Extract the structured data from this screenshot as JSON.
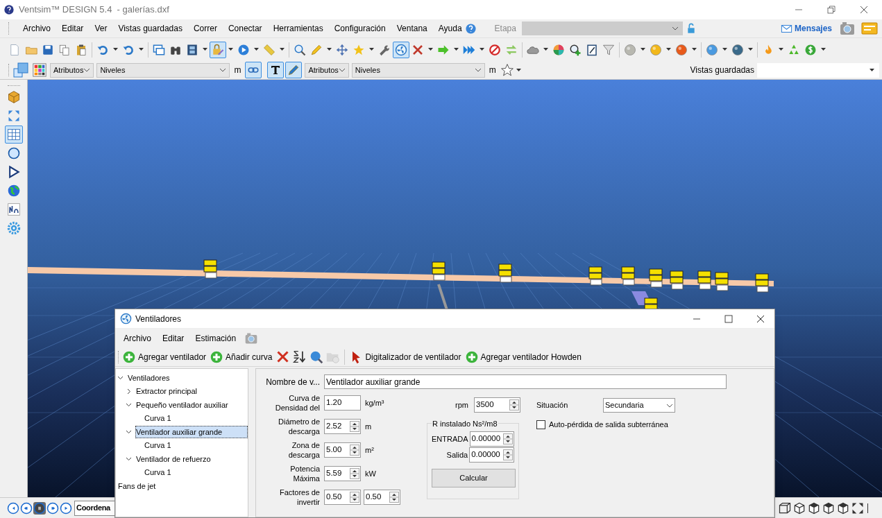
{
  "window": {
    "title": "Ventsim™ DESIGN 5.4  - galerías.dxf"
  },
  "menu": [
    "Archivo",
    "Editar",
    "Ver",
    "Vistas guardadas",
    "Correr",
    "Conectar",
    "Herramientas",
    "Configuración",
    "Ventana",
    "Ayuda"
  ],
  "stage": {
    "label": "Etapa",
    "disabled": true
  },
  "messages": "Mensajes",
  "main_toolbar": [
    {
      "selected": false
    },
    {
      "selected": false
    },
    {
      "selected": false
    },
    {
      "selected": false
    },
    {
      "selected": false
    },
    {
      "selected": false
    },
    {
      "selected": false
    },
    {
      "selected": false
    },
    {
      "selected": false
    },
    {
      "selected": false
    },
    {
      "selected": true
    },
    {
      "selected": false
    },
    {
      "selected": false
    },
    {
      "selected": false
    },
    {
      "selected": false
    },
    {
      "selected": false
    },
    {
      "selected": false
    },
    {
      "selected": false
    },
    {
      "selected": true
    },
    {
      "selected": false
    },
    {
      "selected": false
    },
    {
      "selected": false
    },
    {
      "selected": false
    },
    {
      "selected": false
    },
    {
      "selected": false
    },
    {
      "selected": false
    },
    {
      "selected": false
    },
    {
      "selected": false
    },
    {
      "selected": false
    },
    {
      "selected": false
    },
    {
      "selected": false
    },
    {
      "selected": false
    },
    {
      "selected": false
    },
    {
      "selected": false
    },
    {
      "selected": false
    },
    {
      "selected": false
    },
    {
      "selected": false
    }
  ],
  "view_toolbar": {
    "combos": [
      {
        "value": "Atributos"
      },
      {
        "value": "Niveles"
      },
      {
        "value": "Atributos"
      },
      {
        "value": "Niveles"
      }
    ],
    "units": [
      "m",
      "m"
    ],
    "toggles": [
      {
        "selected": true
      },
      {
        "selected": true
      },
      {
        "selected": true
      }
    ],
    "saved_views_label": "Vistas guardadas"
  },
  "side_toolbar": [
    {
      "selected": false
    },
    {
      "selected": false
    },
    {
      "selected": true
    },
    {
      "selected": false
    },
    {
      "selected": false
    },
    {
      "selected": false
    },
    {
      "selected": false
    },
    {
      "selected": false
    }
  ],
  "status_bar": {
    "playback": [
      {
        "selected": false
      },
      {
        "selected": false
      },
      {
        "selected": true
      },
      {
        "selected": false
      },
      {
        "selected": false
      }
    ],
    "coordinates": "Coordena"
  },
  "dialog": {
    "title": "Ventiladores",
    "menu": [
      "Archivo",
      "Editar",
      "Estimación"
    ],
    "toolbar": [
      {
        "kind": "add",
        "label": "Agregar ventilador",
        "disabled": false
      },
      {
        "kind": "add",
        "label": "Añadir curva",
        "disabled": false
      },
      {
        "kind": "delete",
        "disabled": false
      },
      {
        "kind": "sort",
        "disabled": false
      },
      {
        "kind": "search",
        "disabled": false
      },
      {
        "kind": "upload",
        "disabled": true
      },
      {
        "kind": "pointer",
        "label": "Digitalizador de ventilador",
        "disabled": false
      },
      {
        "kind": "add",
        "label": "Agregar ventilador Howden",
        "disabled": false
      }
    ],
    "tree": [
      {
        "label": "Ventiladores",
        "expanded": true,
        "selected": false,
        "children": [
          {
            "label": "Extractor principal",
            "expanded": false,
            "selected": false
          },
          {
            "label": "Pequeño ventilador auxiliar",
            "expanded": true,
            "selected": false,
            "children": [
              {
                "label": "Curva 1",
                "selected": false
              }
            ]
          },
          {
            "label": "Ventilador auxiliar grande",
            "expanded": true,
            "selected": true,
            "children": [
              {
                "label": "Curva 1",
                "selected": false
              }
            ]
          },
          {
            "label": "Ventilador de refuerzo",
            "expanded": true,
            "selected": false,
            "children": [
              {
                "label": "Curva 1",
                "selected": false
              }
            ]
          }
        ]
      },
      {
        "label": "Fans de jet",
        "selected": false
      }
    ],
    "name_field": {
      "label": "Nombre de v...",
      "value": "Ventilador auxiliar grande"
    },
    "fields": [
      {
        "label": "Curva de\nDensidad del",
        "values": [
          "1.20"
        ],
        "unit": "kg/m³",
        "spin": false
      },
      {
        "label": "Diámetro de\ndescarga",
        "values": [
          "2.52"
        ],
        "unit": "m",
        "spin": true
      },
      {
        "label": "Zona de\ndescarga",
        "values": [
          "5.00"
        ],
        "unit": "m²",
        "spin": true
      },
      {
        "label": "Potencia\nMáxima",
        "values": [
          "5.59"
        ],
        "unit": "kW",
        "spin": true
      },
      {
        "label": "Factores de\ninvertir",
        "values": [
          "0.50",
          "0.50"
        ],
        "spin": true
      }
    ],
    "rpm": {
      "label": "rpm",
      "value": "3500"
    },
    "resistance": {
      "title": "R instalado Ns²/m8",
      "fields": [
        {
          "label": "ENTRADA",
          "value": "0.00000"
        },
        {
          "label": "Salida",
          "value": "0.00000"
        }
      ],
      "button": "Calcular"
    },
    "situation": {
      "label": "Situación",
      "value": "Secundaria"
    },
    "auto_loss": {
      "label": "Auto-pérdida de salida subterránea",
      "checked": false
    }
  }
}
